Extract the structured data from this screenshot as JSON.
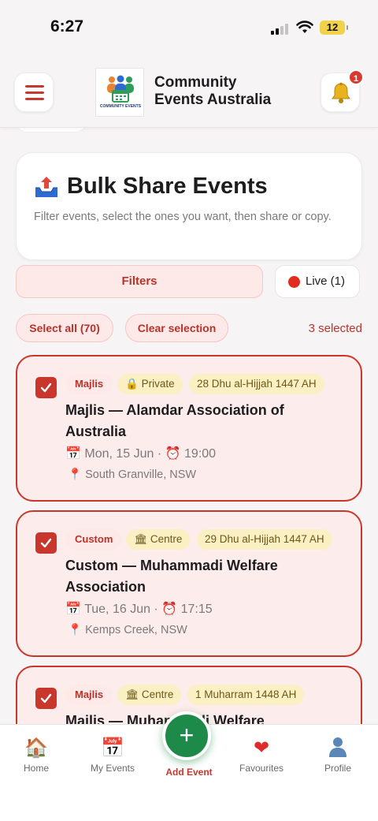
{
  "status_bar": {
    "time": "6:27",
    "battery": "12"
  },
  "header": {
    "logo_text": "COMMUNITY EVENTS",
    "title_line1": "Community",
    "title_line2": "Events Australia",
    "notification_count": "1"
  },
  "bulk_share": {
    "title": "Bulk Share Events",
    "description": "Filter events, select the ones you want, then share or copy."
  },
  "filters": {
    "filters_label": "Filters",
    "live_label": "Live (1)",
    "select_all_label": "Select all (70)",
    "clear_selection_label": "Clear selection",
    "selected_count": "3 selected"
  },
  "events": [
    {
      "type": "Majlis",
      "privacy": "Private",
      "privacy_icon": "lock-icon",
      "hijri_date": "28 Dhu al-Hijjah 1447 AH",
      "title": "Majlis — Alamdar Association of Australia",
      "date": "Mon, 15 Jun",
      "time": "19:00",
      "location": "South Granville, NSW",
      "checked": true
    },
    {
      "type": "Custom",
      "privacy": "Centre",
      "privacy_icon": "building-icon",
      "hijri_date": "29 Dhu al-Hijjah 1447 AH",
      "title": "Custom — Muhammadi Welfare Association",
      "date": "Tue, 16 Jun",
      "time": "17:15",
      "location": "Kemps Creek, NSW",
      "checked": true
    },
    {
      "type": "Majlis",
      "privacy": "Centre",
      "privacy_icon": "building-icon",
      "hijri_date": "1 Muharram 1448 AH",
      "title": "Majlis — Muhammadi Welfare",
      "checked": true
    }
  ],
  "bottom_nav": {
    "home": "Home",
    "my_events": "My Events",
    "add_event": "Add Event",
    "favourites": "Favourites",
    "profile": "Profile"
  },
  "colors": {
    "accent_red": "#c9372c",
    "card_bg": "#fdecec",
    "tag_yellow": "#fbefc4",
    "fab_green": "#1e8a4a"
  }
}
